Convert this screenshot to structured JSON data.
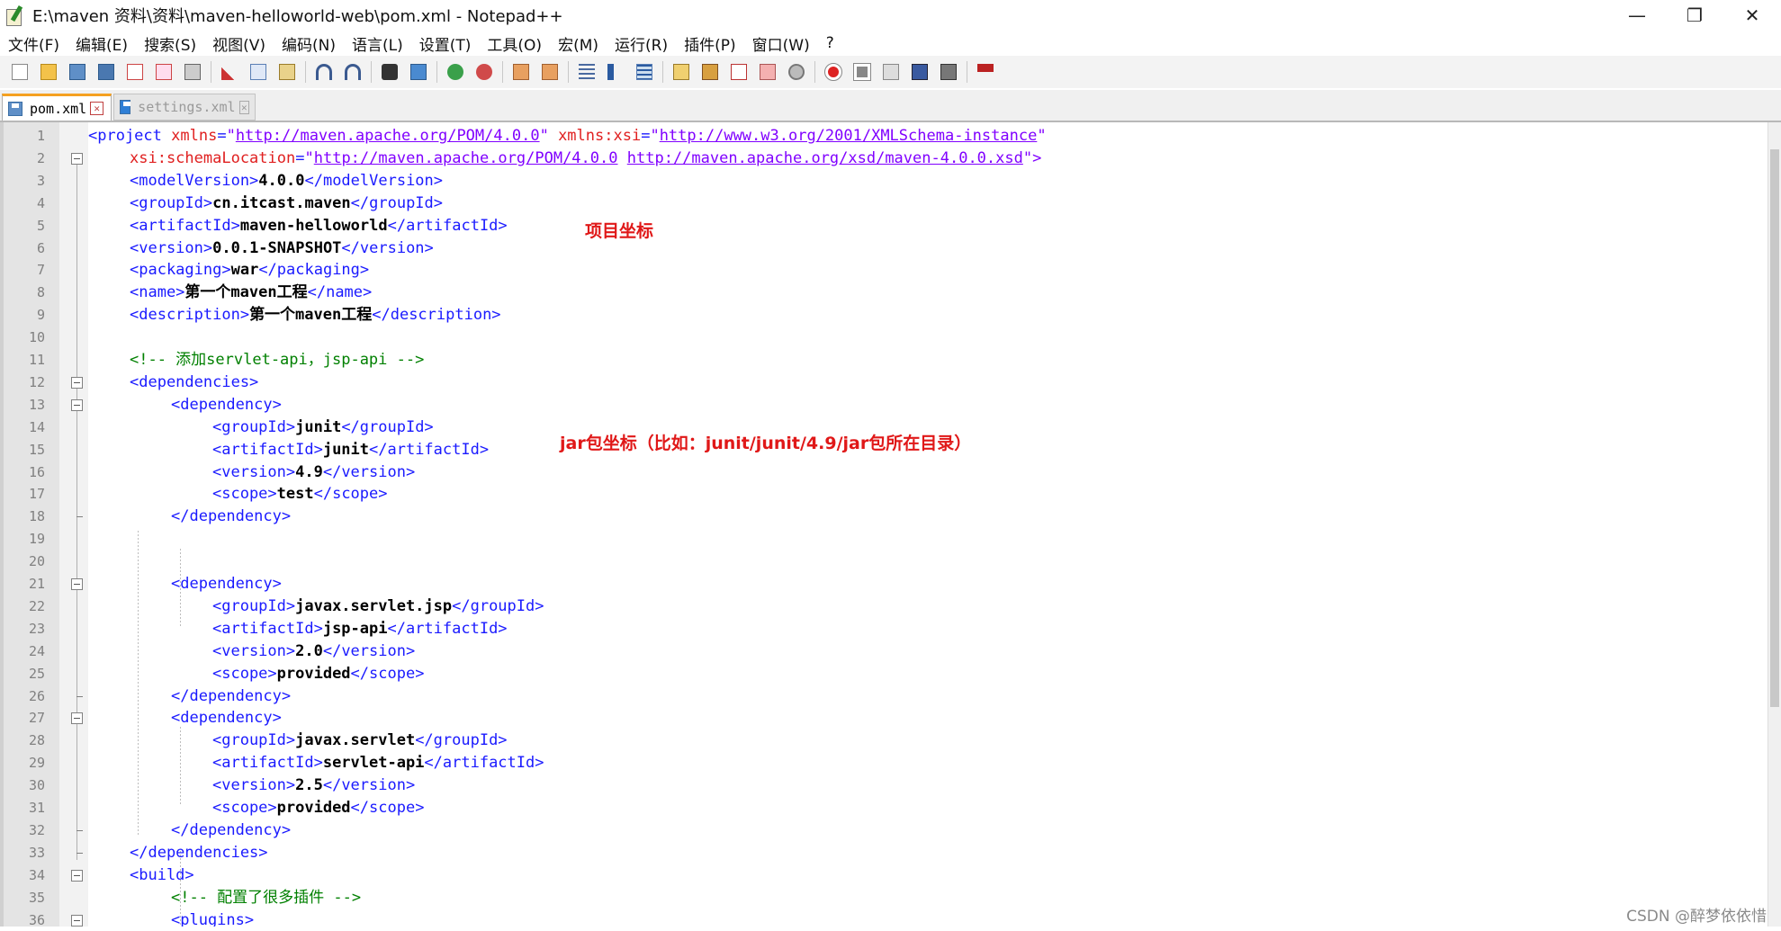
{
  "window": {
    "title": "E:\\maven 资料\\资料\\maven-helloworld-web\\pom.xml - Notepad++",
    "minimize": "—",
    "restore": "❐",
    "close": "✕"
  },
  "menu": [
    "文件(F)",
    "编辑(E)",
    "搜索(S)",
    "视图(V)",
    "编码(N)",
    "语言(L)",
    "设置(T)",
    "工具(O)",
    "宏(M)",
    "运行(R)",
    "插件(P)",
    "窗口(W)",
    "?"
  ],
  "toolbar_icons": [
    "new-icon",
    "open-icon",
    "save-icon",
    "save-all-icon",
    "close-icon",
    "close-all-icon",
    "print-icon",
    "sep",
    "cut-icon",
    "copy-icon",
    "paste-icon",
    "sep",
    "undo-icon",
    "redo-icon",
    "sep",
    "find-icon",
    "replace-icon",
    "sep",
    "zoom-in-icon",
    "zoom-out-icon",
    "sep",
    "sync-v-icon",
    "sync-h-icon",
    "sep",
    "word-wrap-icon",
    "show-all-chars-icon",
    "indent-guide-icon",
    "sep",
    "lang-icon",
    "doc-map-icon",
    "function-list-icon",
    "folder-workspace-icon",
    "monitor-icon",
    "sep",
    "record-macro-icon",
    "stop-macro-icon",
    "play-macro-icon",
    "run-macro-multiple-icon",
    "save-macro-icon",
    "sep",
    "spellcheck-icon"
  ],
  "tabs": [
    {
      "label": "pom.xml",
      "active": true
    },
    {
      "label": "settings.xml",
      "active": false
    }
  ],
  "lines": [
    {
      "n": "1"
    },
    {
      "n": "2"
    },
    {
      "n": "3"
    },
    {
      "n": "4"
    },
    {
      "n": "5"
    },
    {
      "n": "6"
    },
    {
      "n": "7"
    },
    {
      "n": "8"
    },
    {
      "n": "9"
    },
    {
      "n": "10"
    },
    {
      "n": "11"
    },
    {
      "n": "12"
    },
    {
      "n": "13"
    },
    {
      "n": "14"
    },
    {
      "n": "15"
    },
    {
      "n": "16"
    },
    {
      "n": "17"
    },
    {
      "n": "18"
    },
    {
      "n": "19"
    },
    {
      "n": "20"
    },
    {
      "n": "21"
    },
    {
      "n": "22"
    },
    {
      "n": "23"
    },
    {
      "n": "24"
    },
    {
      "n": "25"
    },
    {
      "n": "26"
    },
    {
      "n": "27"
    },
    {
      "n": "28"
    },
    {
      "n": "29"
    },
    {
      "n": "30"
    },
    {
      "n": "31"
    },
    {
      "n": "32"
    },
    {
      "n": "33"
    },
    {
      "n": "34"
    },
    {
      "n": "35"
    },
    {
      "n": "36"
    }
  ],
  "code": {
    "project_open": "<project",
    "xmlns_attr": " xmlns",
    "eq": "=",
    "q": "\"",
    "xmlns_val": "http://maven.apache.org/POM/4.0.0",
    "xsi_attr": " xmlns:xsi",
    "xsi_val": "http://www.w3.org/2001/XMLSchema-instance",
    "schema_attr": "xsi:schemaLocation",
    "schema_val1": "http://maven.apache.org/POM/4.0.0",
    "schema_val2": "http://maven.apache.org/xsd/maven-4.0.0.xsd",
    "close_gt": "\">",
    "model_open": "<modelVersion>",
    "model_val": "4.0.0",
    "model_close": "</modelVersion>",
    "group_open": "<groupId>",
    "group_val": "cn.itcast.maven",
    "group_close": "</groupId>",
    "artifact_open": "<artifactId>",
    "artifact_val": "maven-helloworld",
    "artifact_close": "</artifactId>",
    "version_open": "<version>",
    "version_val": "0.0.1-SNAPSHOT",
    "version_close": "</version>",
    "packaging_open": "<packaging>",
    "packaging_val": "war",
    "packaging_close": "</packaging>",
    "name_open": "<name>",
    "name_val": "第一个maven工程",
    "name_close": "</name>",
    "desc_open": "<description>",
    "desc_val": "第一个maven工程",
    "desc_close": "</description>",
    "comment1": "<!-- 添加servlet-api，jsp-api -->",
    "deps_open": "<dependencies>",
    "dep_open": "<dependency>",
    "dep_close": "</dependency>",
    "d1_group": "junit",
    "d1_artifact": "junit",
    "d1_version": "4.9",
    "scope_open": "<scope>",
    "scope_close": "</scope>",
    "d1_scope": "test",
    "d2_group": "javax.servlet.jsp",
    "d2_artifact": "jsp-api",
    "d2_version": "2.0",
    "d2_scope": "provided",
    "d3_group": "javax.servlet",
    "d3_artifact": "servlet-api",
    "d3_version": "2.5",
    "d3_scope": "provided",
    "deps_close": "</dependencies>",
    "build_open": "<build>",
    "comment2": "<!-- 配置了很多插件 -->",
    "plugins_open": "<plugins>"
  },
  "annotations": {
    "project_coords": "项目坐标",
    "jar_coords": "jar包坐标（比如：junit/junit/4.9/jar包所在目录）"
  },
  "watermark": "CSDN @醉梦依依惜",
  "colors": {
    "tag": "#1a1aff",
    "attr": "#e02020",
    "value": "#8000ff",
    "comment": "#008000",
    "annotation": "#e01818",
    "tab_accent": "#f5a020"
  }
}
